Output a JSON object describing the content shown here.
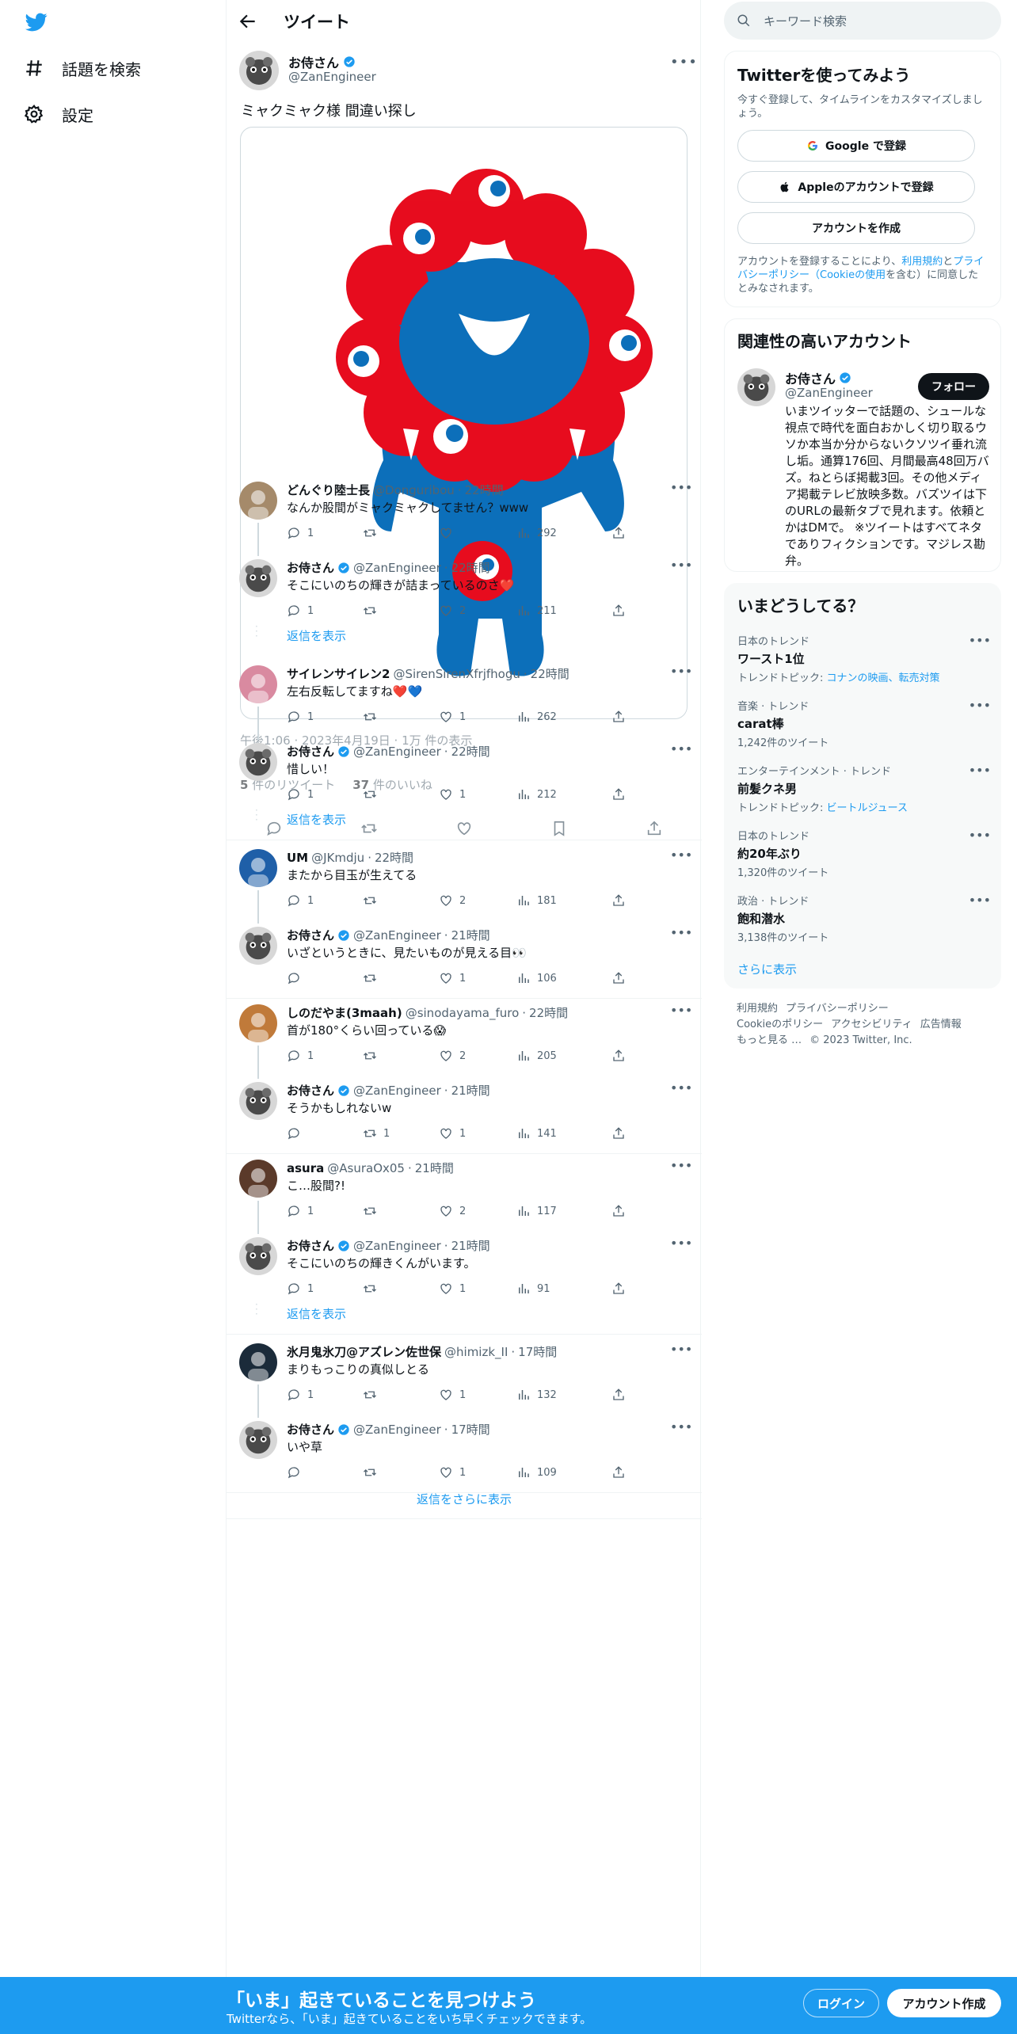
{
  "nav": {
    "explore_label": "話題を検索",
    "settings_label": "設定"
  },
  "header": {
    "title": "ツイート"
  },
  "main_tweet": {
    "name": "お侍さん",
    "handle": "@ZanEngineer",
    "text": "ミャクミャク様 間違い探し",
    "meta": "午後1:06 · 2023年4月19日 · 1万 件の表示",
    "retweets_count": "5",
    "retweets_label": "件のリツイート",
    "likes_count": "37",
    "likes_label": "件のいいね"
  },
  "replies": [
    {
      "name": "どんぐり陸士長",
      "handle": "@Donguribou",
      "time": "22時間",
      "text": "なんか股間がミャクミャクしてません？www",
      "reply": "1",
      "retweet": "",
      "like": "",
      "views": "292"
    },
    {
      "name": "お侍さん",
      "handle": "@ZanEngineer",
      "time": "22時間",
      "text": "そこにいのちの輝きが詰まっているのさ❤️",
      "reply": "1",
      "retweet": "",
      "like": "2",
      "views": "211"
    },
    {
      "name": "サイレンサイレン2",
      "handle": "@SirenSirenXfrjfhogu",
      "time": "22時間",
      "text": "左右反転してますね❤️💙",
      "reply": "1",
      "retweet": "",
      "like": "1",
      "views": "262"
    },
    {
      "name": "お侍さん",
      "handle": "@ZanEngineer",
      "time": "22時間",
      "text": "惜しい！",
      "reply": "1",
      "retweet": "",
      "like": "1",
      "views": "212"
    },
    {
      "name": "UM",
      "handle": "@JKmdju",
      "time": "22時間",
      "text": "またから目玉が生えてる",
      "reply": "1",
      "retweet": "",
      "like": "2",
      "views": "181"
    },
    {
      "name": "お侍さん",
      "handle": "@ZanEngineer",
      "time": "21時間",
      "text": "いざというときに、見たいものが見える目👀",
      "reply": "",
      "retweet": "",
      "like": "1",
      "views": "106"
    },
    {
      "name": "しのだやま(3maah)",
      "handle": "@sinodayama_furo",
      "time": "22時間",
      "text": "首が180°くらい回っている😱",
      "reply": "1",
      "retweet": "",
      "like": "2",
      "views": "205"
    },
    {
      "name": "お侍さん",
      "handle": "@ZanEngineer",
      "time": "21時間",
      "text": "そうかもしれないw",
      "reply": "",
      "retweet": "1",
      "like": "1",
      "views": "141"
    },
    {
      "name": "asura",
      "handle": "@AsuraOx05",
      "time": "21時間",
      "text": "こ…股間?!",
      "reply": "1",
      "retweet": "",
      "like": "2",
      "views": "117"
    },
    {
      "name": "お侍さん",
      "handle": "@ZanEngineer",
      "time": "21時間",
      "text": "そこにいのちの輝きくんがいます。",
      "reply": "1",
      "retweet": "",
      "like": "1",
      "views": "91"
    },
    {
      "name": "氷月鬼氷刀@アズレン佐世保",
      "handle": "@himizk_II",
      "time": "17時間",
      "text": "まりもっこりの真似しとる",
      "reply": "1",
      "retweet": "",
      "like": "1",
      "views": "132"
    },
    {
      "name": "お侍さん",
      "handle": "@ZanEngineer",
      "time": "17時間",
      "text": "いや草",
      "reply": "",
      "retweet": "",
      "like": "1",
      "views": "109"
    }
  ],
  "show_replies_label": "返信を表示",
  "show_more_replies_label": "返信をさらに表示",
  "search": {
    "placeholder": "キーワード検索"
  },
  "signup": {
    "title": "Twitterを使ってみよう",
    "subtitle": "今すぐ登録して、タイムラインをカスタマイズしましょう。",
    "google_label": "Google で登録",
    "apple_label": "Appleのアカウントで登録",
    "create_label": "アカウントを作成",
    "terms_pre": "アカウントを登録することにより、",
    "terms_link1": "利用規約",
    "terms_mid": "と",
    "terms_link2": "プライバシーポリシー（Cookieの使用",
    "terms_post": "を含む）に同意したとみなされます。"
  },
  "related": {
    "title": "関連性の高いアカウント",
    "name": "お侍さん",
    "handle": "@ZanEngineer",
    "follow_label": "フォロー",
    "bio": "いまツイッターで話題の、シュールな視点で時代を面白おかしく切り取るウソか本当か分からないクソツイ垂れ流し垢。通算176回、月間最高48回万バズ。ねとらぼ掲載3回。その他メディア掲載テレビ放映多数。バズツイは下のURLの最新タブで見れます。依頼とかはDMで。 ※ツイートはすべてネタでありフィクションです。マジレス勘弁。"
  },
  "trends": {
    "title": "いまどうしてる？",
    "items": [
      {
        "category": "日本のトレンド",
        "name": "ワースト1位",
        "sub_prefix": "トレンドトピック: ",
        "sub_link": "コナンの映画、転売対策"
      },
      {
        "category": "音楽 · トレンド",
        "name": "carat棒",
        "sub_prefix": "1,242件のツイート",
        "sub_link": ""
      },
      {
        "category": "エンターテインメント · トレンド",
        "name": "前髪クネ男",
        "sub_prefix": "トレンドトピック: ",
        "sub_link": "ビートルジュース"
      },
      {
        "category": "日本のトレンド",
        "name": "約20年ぶり",
        "sub_prefix": "1,320件のツイート",
        "sub_link": ""
      },
      {
        "category": "政治 · トレンド",
        "name": "飽和潜水",
        "sub_prefix": "3,138件のツイート",
        "sub_link": ""
      }
    ],
    "show_more": "さらに表示"
  },
  "footer": {
    "links": [
      "利用規約",
      "プライバシーポリシー",
      "Cookieのポリシー",
      "アクセシビリティ",
      "広告情報",
      "もっと見る …"
    ],
    "copyright": "© 2023 Twitter, Inc."
  },
  "bottom_bar": {
    "title": "「いま」起きていることを見つけよう",
    "subtitle": "Twitterなら、「いま」起きていることをいち早くチェックできます。",
    "login_label": "ログイン",
    "signup_label": "アカウント作成"
  },
  "colors": {
    "accent": "#1d9bf0",
    "text": "#0f1419",
    "muted": "#536471",
    "mascot_red": "#e60012",
    "mascot_blue": "#0068b7"
  }
}
